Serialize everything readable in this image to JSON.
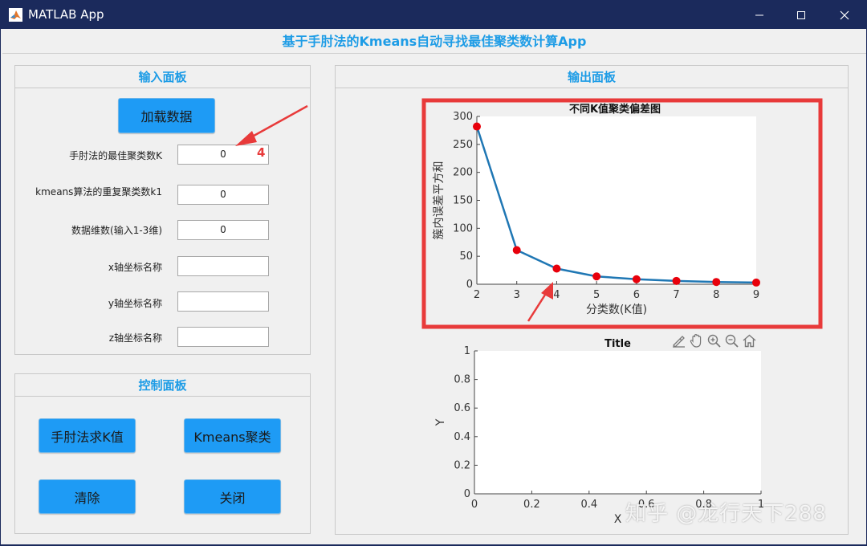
{
  "window": {
    "title": "MATLAB App"
  },
  "header": {
    "title": "基于手肘法的Kmeans自动寻找最佳聚类数计算App"
  },
  "input_panel": {
    "title": "输入面板",
    "load_button": "加载数据",
    "fields": [
      {
        "label": "手肘法的最佳聚类数K",
        "value": "0"
      },
      {
        "label": "kmeans算法的重复聚类数k1",
        "value": "0"
      },
      {
        "label": "数据维数(输入1-3维)",
        "value": "0"
      },
      {
        "label": "x轴坐标名称",
        "value": ""
      },
      {
        "label": "y轴坐标名称",
        "value": ""
      },
      {
        "label": "z轴坐标名称",
        "value": ""
      }
    ],
    "annotation": "4"
  },
  "control_panel": {
    "title": "控制面板",
    "buttons": [
      "手肘法求K值",
      "Kmeans聚类",
      "清除",
      "关闭"
    ]
  },
  "output_panel": {
    "title": "输出面板"
  },
  "chart_data": [
    {
      "type": "line",
      "title": "不同K值聚类偏差图",
      "xlabel": "分类数(K值)",
      "ylabel": "簇内误差平方和",
      "x": [
        2,
        3,
        4,
        5,
        6,
        7,
        8,
        9
      ],
      "y": [
        282,
        61,
        28,
        14,
        9,
        6,
        4,
        3
      ],
      "xlim": [
        2,
        9
      ],
      "ylim": [
        0,
        300
      ],
      "xticks": [
        "2",
        "3",
        "4",
        "5",
        "6",
        "7",
        "8",
        "9"
      ],
      "yticks": [
        "0",
        "50",
        "100",
        "150",
        "200",
        "250",
        "300"
      ],
      "line_color": "#1f77b4",
      "marker_color": "#e8000b",
      "highlight_box_color": "#e83a3a"
    },
    {
      "type": "line",
      "title": "Title",
      "xlabel": "X",
      "ylabel": "Y",
      "x": [],
      "y": [],
      "xlim": [
        0,
        1
      ],
      "ylim": [
        0,
        1
      ],
      "xticks": [
        "0",
        "0.2",
        "0.4",
        "0.6",
        "0.8",
        "1"
      ],
      "yticks": [
        "0",
        "0.2",
        "0.4",
        "0.6",
        "0.8",
        "1"
      ]
    }
  ],
  "axes_toolbar": [
    "brush-icon",
    "pan-icon",
    "zoom-in-icon",
    "zoom-out-icon",
    "home-icon"
  ],
  "watermark": "知乎 @龙行天下288"
}
